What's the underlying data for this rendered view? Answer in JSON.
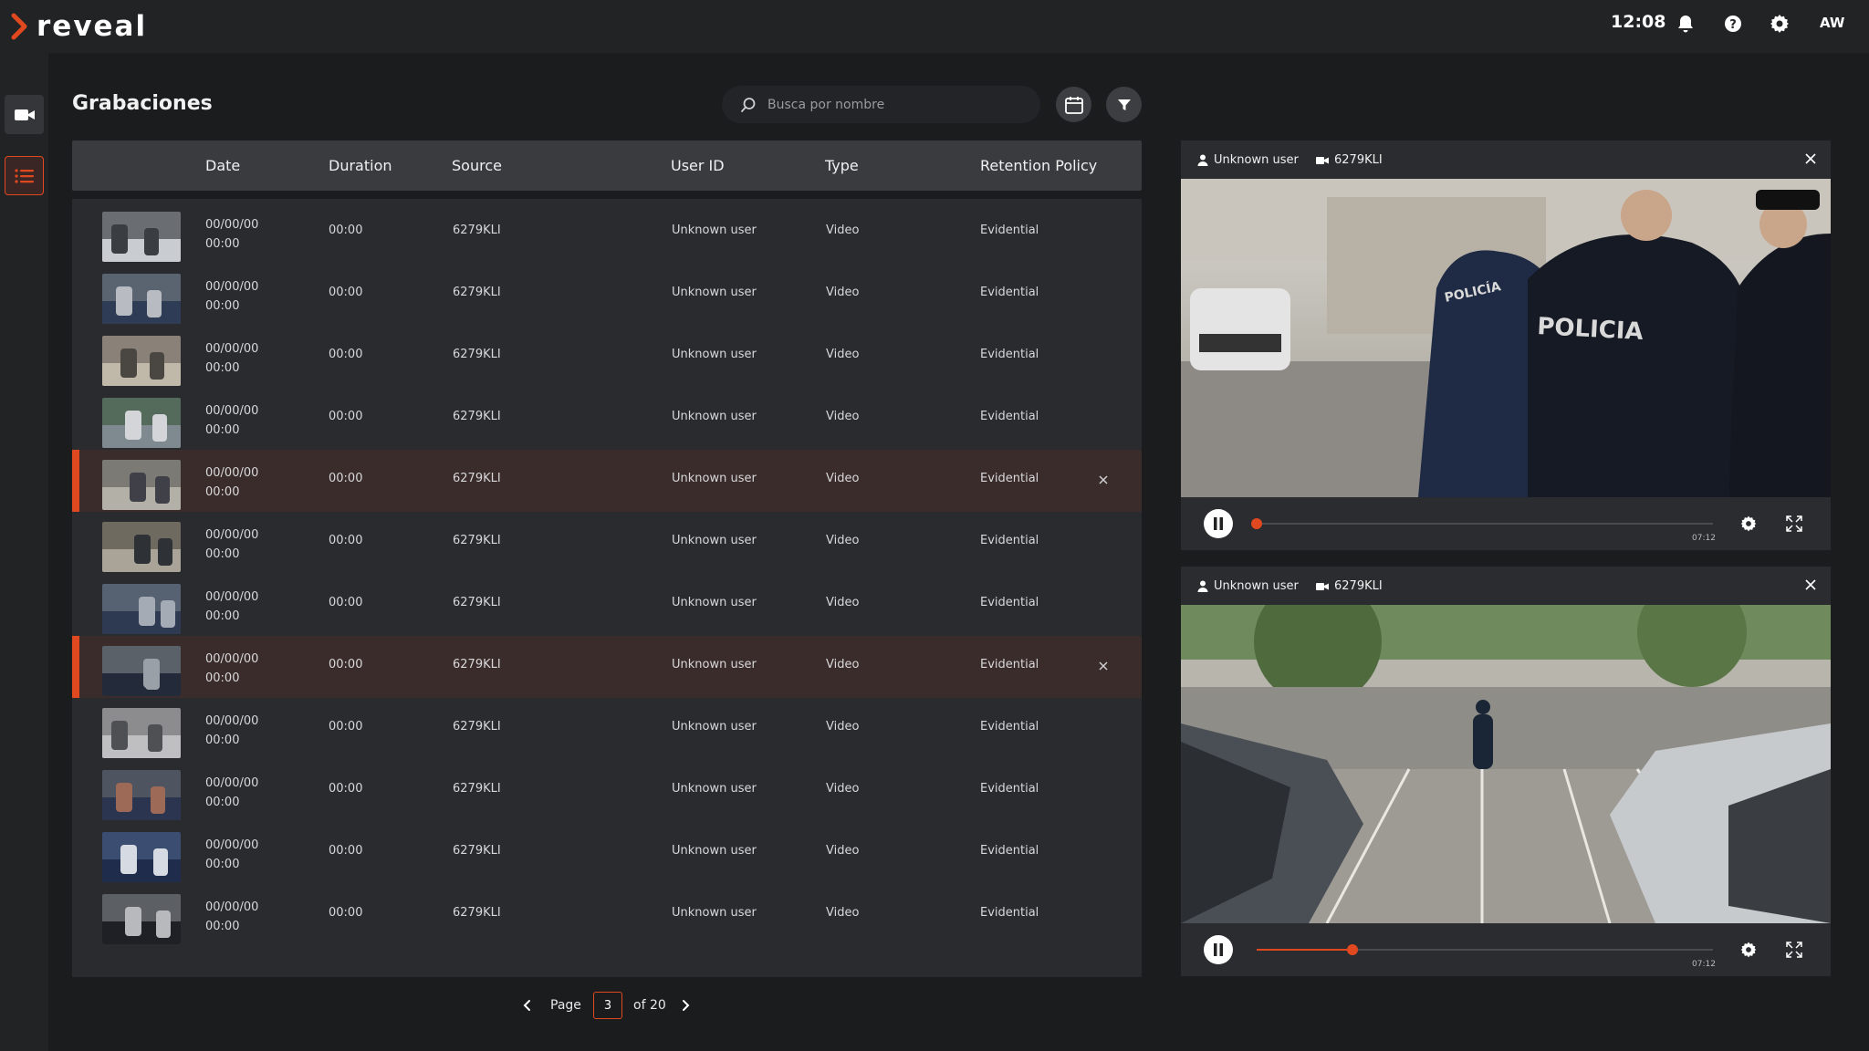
{
  "app": {
    "name": "reveal",
    "accent": "#e0481f"
  },
  "topbar": {
    "time": "12:08",
    "user_initials": "AW",
    "icons": [
      "bell-icon",
      "help-icon",
      "gear-icon"
    ]
  },
  "sidebar": {
    "items": [
      {
        "name": "recordings-video",
        "icon": "video-camera-icon",
        "active": false
      },
      {
        "name": "list",
        "icon": "list-icon",
        "active": true
      }
    ]
  },
  "page": {
    "title": "Grabaciones"
  },
  "search": {
    "placeholder": "Busca por nombre"
  },
  "table": {
    "columns": [
      "Date",
      "Duration",
      "Source",
      "User ID",
      "Type",
      "Retention Policy"
    ],
    "rows": [
      {
        "date": "00/00/00",
        "time": "00:00",
        "duration": "00:00",
        "source": "6279KLI",
        "user": "Unknown user",
        "type": "Video",
        "retention": "Evidential",
        "selected": false
      },
      {
        "date": "00/00/00",
        "time": "00:00",
        "duration": "00:00",
        "source": "6279KLI",
        "user": "Unknown user",
        "type": "Video",
        "retention": "Evidential",
        "selected": false
      },
      {
        "date": "00/00/00",
        "time": "00:00",
        "duration": "00:00",
        "source": "6279KLI",
        "user": "Unknown user",
        "type": "Video",
        "retention": "Evidential",
        "selected": false
      },
      {
        "date": "00/00/00",
        "time": "00:00",
        "duration": "00:00",
        "source": "6279KLI",
        "user": "Unknown user",
        "type": "Video",
        "retention": "Evidential",
        "selected": false
      },
      {
        "date": "00/00/00",
        "time": "00:00",
        "duration": "00:00",
        "source": "6279KLI",
        "user": "Unknown user",
        "type": "Video",
        "retention": "Evidential",
        "selected": true
      },
      {
        "date": "00/00/00",
        "time": "00:00",
        "duration": "00:00",
        "source": "6279KLI",
        "user": "Unknown user",
        "type": "Video",
        "retention": "Evidential",
        "selected": false
      },
      {
        "date": "00/00/00",
        "time": "00:00",
        "duration": "00:00",
        "source": "6279KLI",
        "user": "Unknown user",
        "type": "Video",
        "retention": "Evidential",
        "selected": false
      },
      {
        "date": "00/00/00",
        "time": "00:00",
        "duration": "00:00",
        "source": "6279KLI",
        "user": "Unknown user",
        "type": "Video",
        "retention": "Evidential",
        "selected": true
      },
      {
        "date": "00/00/00",
        "time": "00:00",
        "duration": "00:00",
        "source": "6279KLI",
        "user": "Unknown user",
        "type": "Video",
        "retention": "Evidential",
        "selected": false
      },
      {
        "date": "00/00/00",
        "time": "00:00",
        "duration": "00:00",
        "source": "6279KLI",
        "user": "Unknown user",
        "type": "Video",
        "retention": "Evidential",
        "selected": false
      },
      {
        "date": "00/00/00",
        "time": "00:00",
        "duration": "00:00",
        "source": "6279KLI",
        "user": "Unknown user",
        "type": "Video",
        "retention": "Evidential",
        "selected": false
      },
      {
        "date": "00/00/00",
        "time": "00:00",
        "duration": "00:00",
        "source": "6279KLI",
        "user": "Unknown user",
        "type": "Video",
        "retention": "Evidential",
        "selected": false
      }
    ]
  },
  "pagination": {
    "label": "Page",
    "current": "3",
    "total": "of 20"
  },
  "players": [
    {
      "user": "Unknown user",
      "source": "6279KLI",
      "duration": "07:12",
      "progress": 0.0,
      "state": "playing"
    },
    {
      "user": "Unknown user",
      "source": "6279KLI",
      "duration": "07:12",
      "progress": 0.21,
      "state": "playing"
    }
  ]
}
